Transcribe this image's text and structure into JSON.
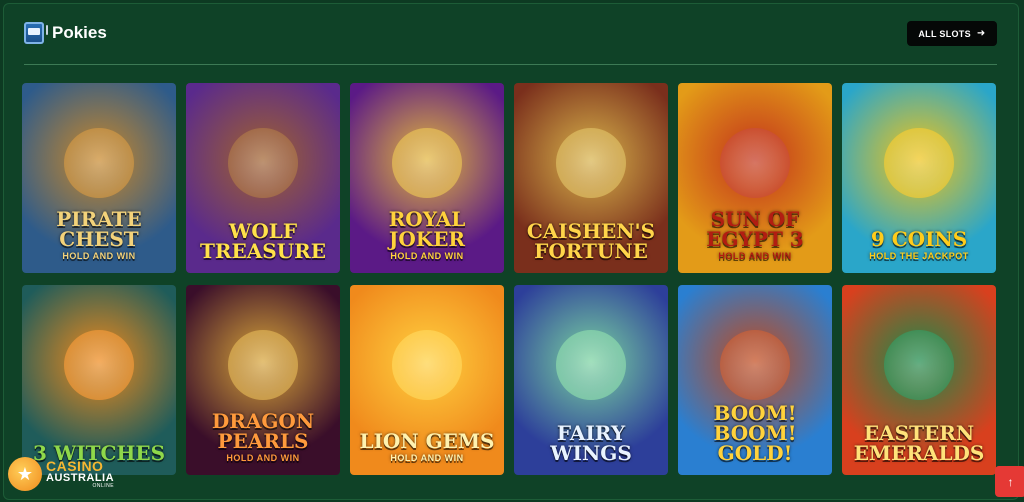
{
  "section": {
    "icon": "slot-machine-icon",
    "title": "Pokies",
    "all_button_label": "ALL SLOTS",
    "all_button_icon": "arrow-right-icon"
  },
  "games": [
    {
      "title": "Pirate Chest",
      "subtitle": "Hold and Win",
      "bg": "#2e5b8a",
      "accent": "#c9882a",
      "color": "#f3d27a"
    },
    {
      "title": "Wolf Treasure",
      "subtitle": "",
      "bg": "#5a2a8c",
      "accent": "#a0622e",
      "color": "#ffe14a"
    },
    {
      "title": "Royal Joker",
      "subtitle": "Hold and Win",
      "bg": "#5b1a86",
      "accent": "#e3b63d",
      "color": "#ffd23c"
    },
    {
      "title": "Caishen's Fortune",
      "subtitle": "",
      "bg": "#7a2f1c",
      "accent": "#d8b34b",
      "color": "#ffd54a"
    },
    {
      "title": "Sun of Egypt 3",
      "subtitle": "Hold and Win",
      "bg": "#e39b18",
      "accent": "#c2331b",
      "color": "#b21d12"
    },
    {
      "title": "9 Coins",
      "subtitle": "Hold the Jackpot",
      "bg": "#2aa6c9",
      "accent": "#f0c419",
      "color": "#ffcc1a"
    },
    {
      "title": "3 Witches",
      "subtitle": "",
      "bg": "#1f5c5a",
      "accent": "#f08a1c",
      "color": "#8fd84a"
    },
    {
      "title": "Dragon Pearls",
      "subtitle": "Hold and Win",
      "bg": "#3a0e2a",
      "accent": "#d8a53a",
      "color": "#ff9a3c"
    },
    {
      "title": "Lion Gems",
      "subtitle": "Hold and Win",
      "bg": "#f08a1c",
      "accent": "#ffd040",
      "color": "#fff2b0"
    },
    {
      "title": "Fairy Wings",
      "subtitle": "",
      "bg": "#2d3f9a",
      "accent": "#7ad3a0",
      "color": "#e9f3ff"
    },
    {
      "title": "Boom! Boom! Gold!",
      "subtitle": "",
      "bg": "#2a7fd1",
      "accent": "#c24a1c",
      "color": "#ffd23c"
    },
    {
      "title": "Eastern Emeralds",
      "subtitle": "",
      "bg": "#d8401e",
      "accent": "#1b8a4a",
      "color": "#ffe27a"
    }
  ],
  "logo": {
    "line1": "CASINO",
    "line2": "AUSTRALIA",
    "line3": "ONLINE"
  },
  "scroll_top_icon": "arrow-up-icon"
}
